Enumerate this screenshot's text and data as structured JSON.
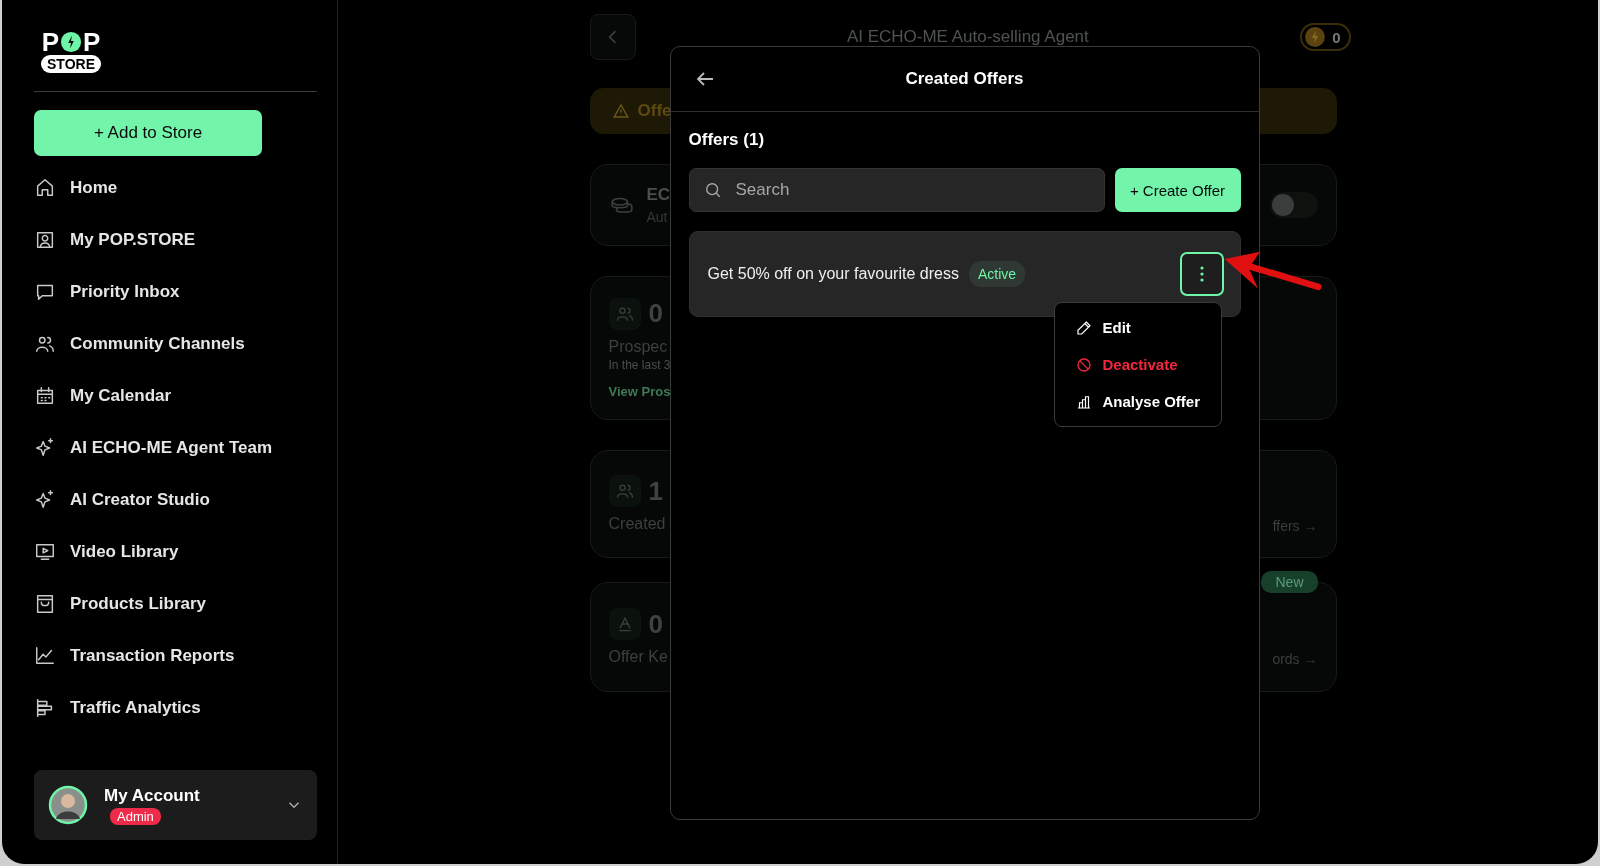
{
  "sidebar": {
    "logo": {
      "left": "P",
      "right": "P",
      "badge": "STORE"
    },
    "add_button": "+ Add to Store",
    "items": [
      {
        "label": "Home"
      },
      {
        "label": "My POP.STORE"
      },
      {
        "label": "Priority Inbox"
      },
      {
        "label": "Community Channels"
      },
      {
        "label": "My Calendar"
      },
      {
        "label": "AI ECHO-ME Agent Team"
      },
      {
        "label": "AI Creator Studio"
      },
      {
        "label": "Video Library"
      },
      {
        "label": "Products Library"
      },
      {
        "label": "Transaction Reports"
      },
      {
        "label": "Traffic Analytics"
      }
    ],
    "account": {
      "name": "My Account",
      "role": "Admin"
    }
  },
  "background": {
    "title": "AI ECHO-ME Auto-selling Agent",
    "credits": "0",
    "banner": "Offe",
    "agent_card": {
      "title": "EC",
      "subtitle": "Aut",
      "on": false
    },
    "prospects_card": {
      "count": "0",
      "label": "Prospec",
      "note": "In the last 3",
      "link": "View Pros"
    },
    "created_card": {
      "count": "1",
      "label": "Created",
      "link": "ffers →"
    },
    "keywords_card": {
      "count": "0",
      "label": "Offer Ke",
      "badge": "New",
      "link": "ords →"
    }
  },
  "modal": {
    "title": "Created Offers",
    "section": "Offers (1)",
    "search": {
      "placeholder": "Search"
    },
    "create_button": "+ Create Offer",
    "offers": [
      {
        "title": "Get 50% off on your favourite dress",
        "status": "Active",
        "menu_open": true
      }
    ],
    "menu": [
      {
        "label": "Edit",
        "kind": "normal"
      },
      {
        "label": "Deactivate",
        "kind": "danger"
      },
      {
        "label": "Analyse Offer",
        "kind": "normal"
      }
    ]
  }
}
